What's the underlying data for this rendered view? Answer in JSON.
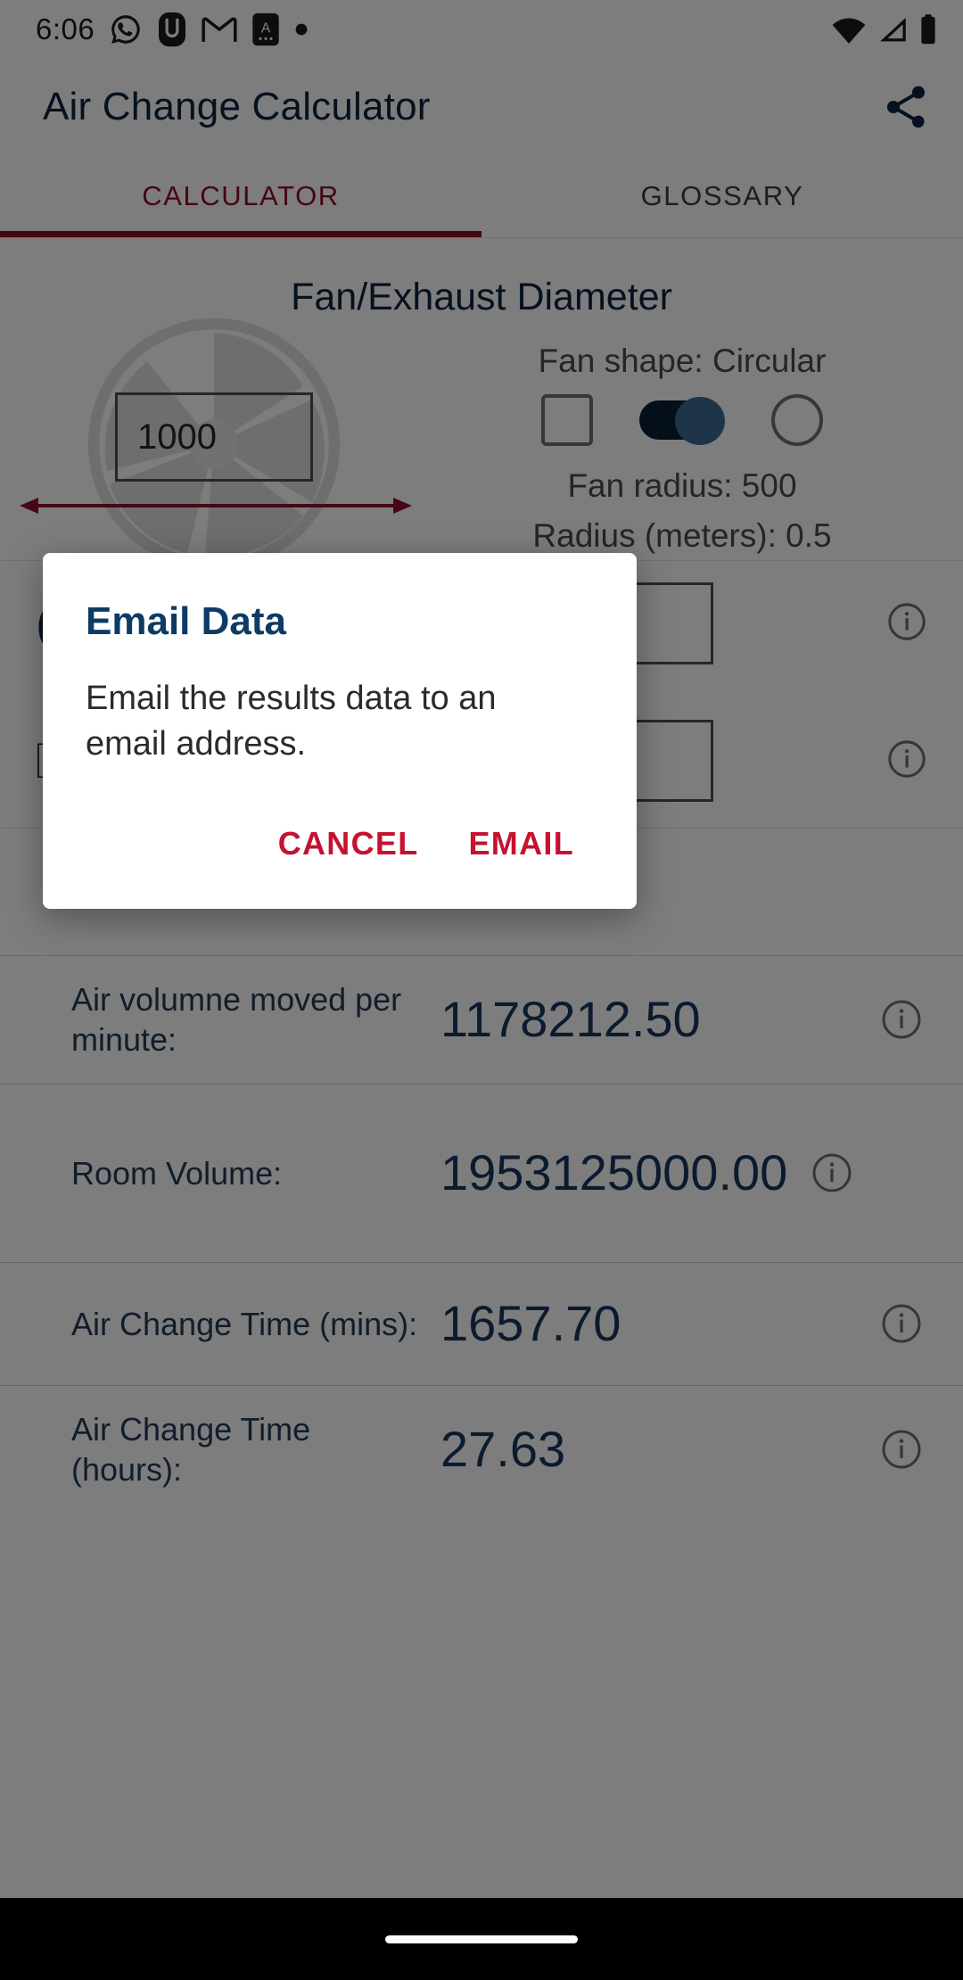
{
  "status_bar": {
    "time": "6:06",
    "left_icons": [
      "whatsapp-icon",
      "u-app-icon",
      "gmail-icon",
      "a-app-icon",
      "dot-icon"
    ],
    "right_icons": [
      "wifi-icon",
      "cellular-signal-icon",
      "battery-icon"
    ]
  },
  "app_bar": {
    "title": "Air Change Calculator",
    "share_icon": "share-icon"
  },
  "tabs": [
    {
      "label": "CALCULATOR",
      "active": true
    },
    {
      "label": "GLOSSARY",
      "active": false
    }
  ],
  "calculator": {
    "diameter_section": {
      "title": "Fan/Exhaust Diameter",
      "input_value": "1000",
      "input_placeholder": "",
      "fan_shape_label": "Fan shape: Circular",
      "fan_radius_label": "Fan radius: 500",
      "radius_meters_label": "Radius (meters): 0.5",
      "controls": [
        {
          "type": "checkbox",
          "name": "square-shape-checkbox",
          "checked": false
        },
        {
          "type": "switch",
          "name": "shape-toggle-switch",
          "on": true
        },
        {
          "type": "radio",
          "name": "circular-shape-radio",
          "checked": false
        }
      ]
    }
  },
  "results": {
    "rows": [
      {
        "label": "Air volumne moved per minute:",
        "value": "1178212.50",
        "info_icon": "info-icon"
      },
      {
        "label": "Room Volume:",
        "value": "1953125000.00",
        "info_icon": "info-icon"
      },
      {
        "label": "Air Change Time (mins):",
        "value": "1657.70",
        "info_icon": "info-icon"
      },
      {
        "label": "Air Change Time (hours):",
        "value": "27.63",
        "info_icon": "info-icon"
      }
    ]
  },
  "dialog": {
    "title": "Email Data",
    "body": "Email the results data to an email address.",
    "cancel_label": "CANCEL",
    "confirm_label": "EMAIL"
  },
  "colors": {
    "accent_red": "#8c0b26",
    "dialog_action_red": "#c4122f",
    "navy": "#0d2340",
    "dialog_title_blue": "#0d3b66",
    "switch_track": "#0a1e33",
    "switch_thumb": "#3d6b93",
    "arrow_red": "#8c1028"
  },
  "nav_bar": {
    "pill": "home-gesture-pill"
  }
}
